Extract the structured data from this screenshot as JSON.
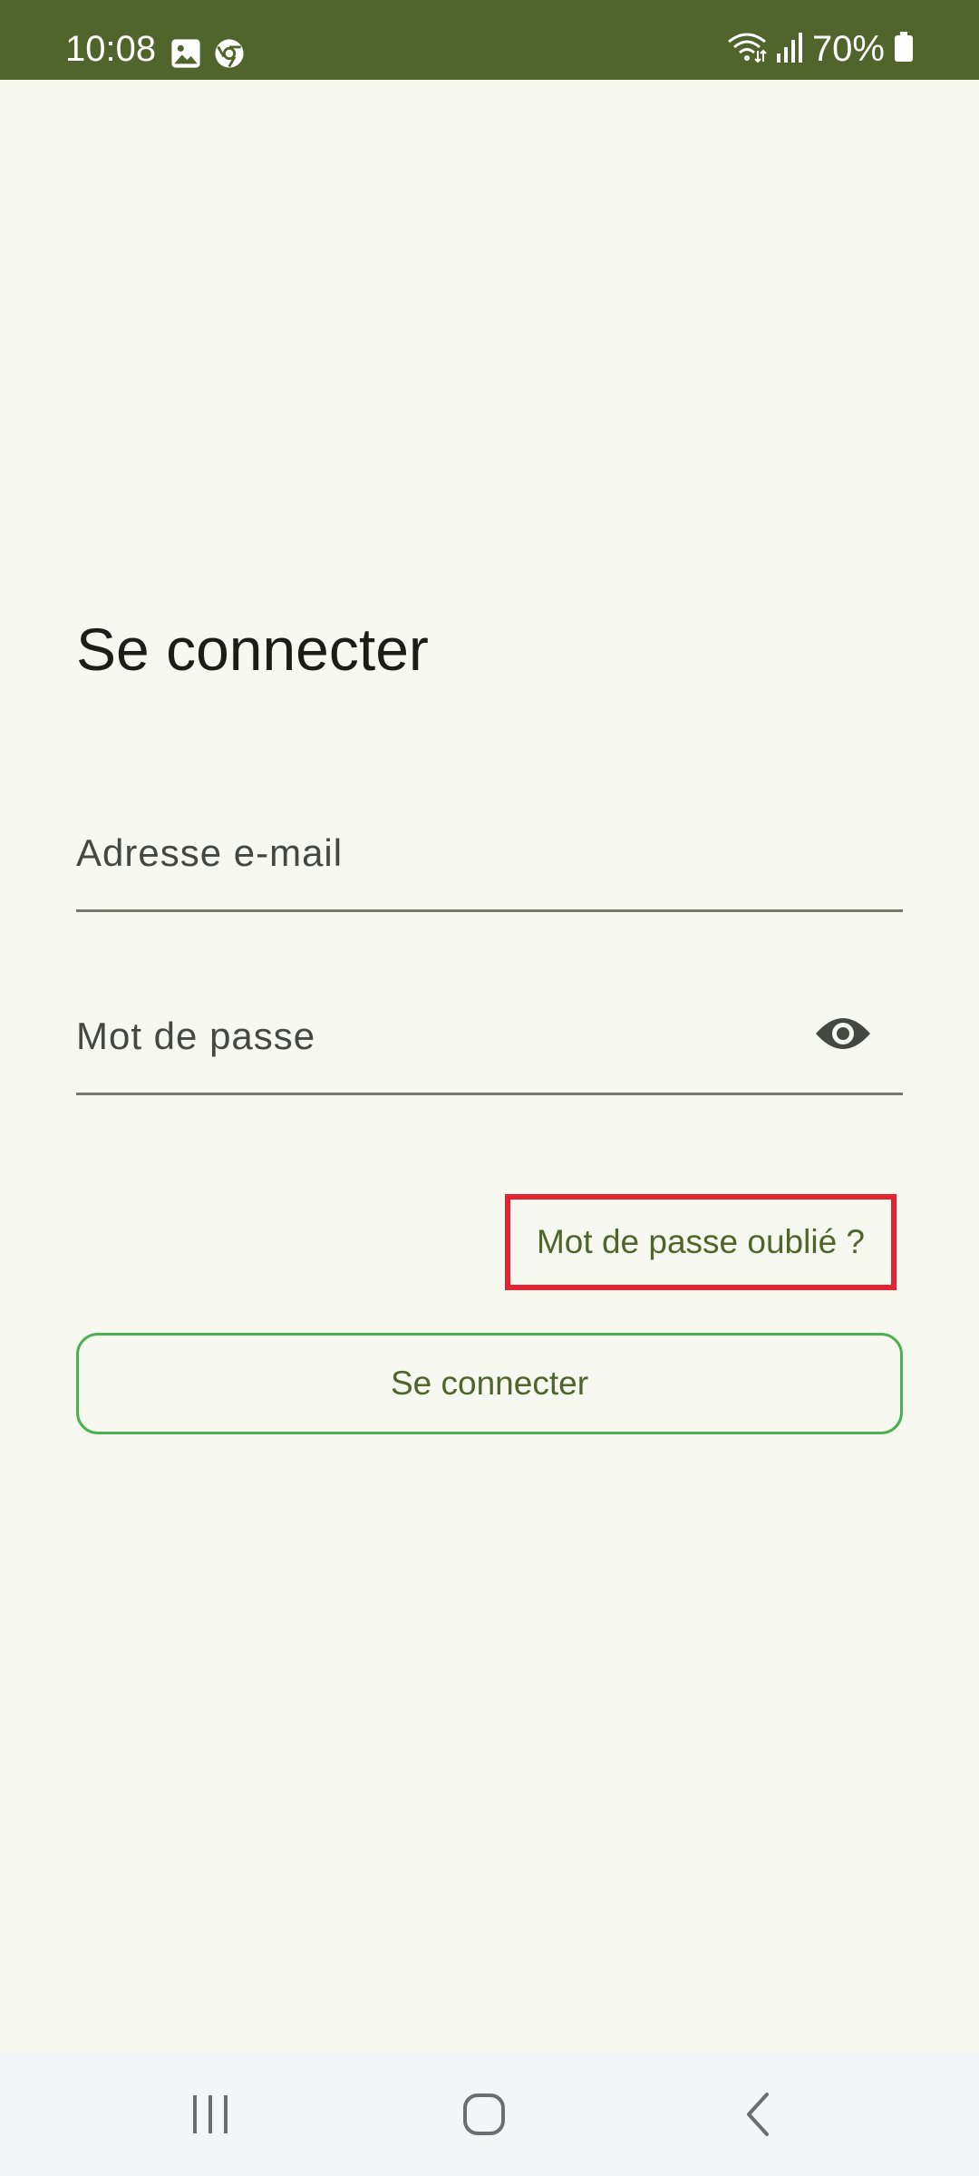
{
  "status_bar": {
    "time": "10:08",
    "battery": "70%",
    "icons": [
      "image-icon",
      "chrome-icon",
      "wifi-icon",
      "signal-icon",
      "battery-icon"
    ]
  },
  "login": {
    "title": "Se connecter",
    "email_placeholder": "Adresse e-mail",
    "password_placeholder": "Mot de passe",
    "forgot_password": "Mot de passe oublié ?",
    "submit_label": "Se connecter"
  },
  "colors": {
    "status_bar": "#4f652c",
    "background": "#f7f8f0",
    "accent_text": "#4f652c",
    "button_border": "#4caf50",
    "highlight_box": "#e3232f"
  },
  "nav_bar": {
    "buttons": [
      "recent-apps",
      "home",
      "back"
    ]
  }
}
